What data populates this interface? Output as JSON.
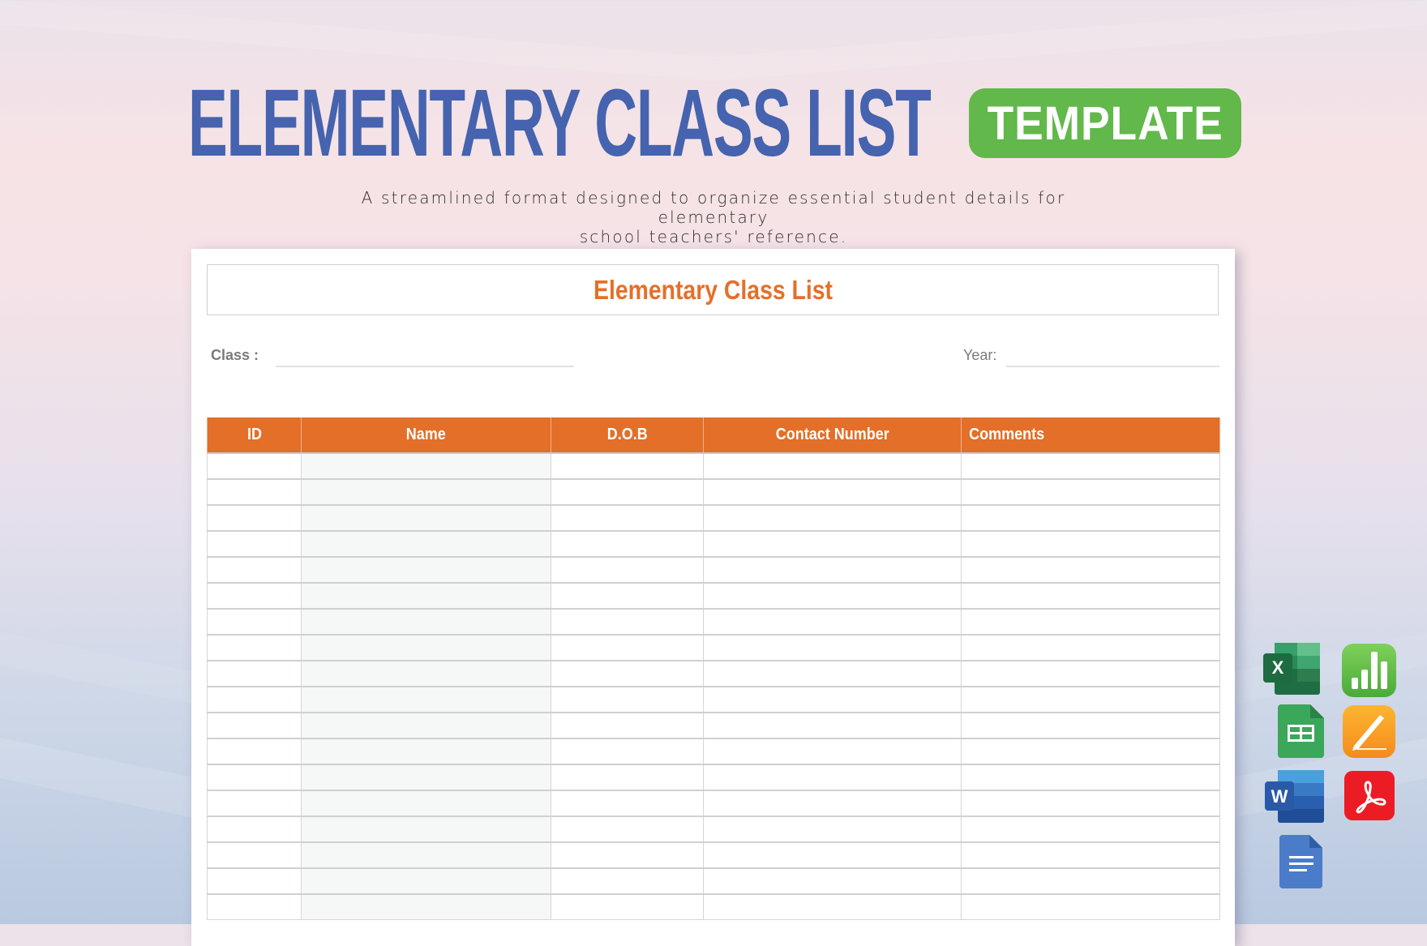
{
  "header": {
    "title": "ELEMENTARY CLASS LIST",
    "badge": "TEMPLATE",
    "subtitle_line1": "A streamlined format designed to organize essential student details for elementary",
    "subtitle_line2": "school teachers' reference."
  },
  "document": {
    "title": "Elementary Class List",
    "class_label": "Class :",
    "class_value": "",
    "year_label": "Year:",
    "year_value": "",
    "table": {
      "columns": [
        "ID",
        "Name",
        "D.O.B",
        "Contact Number",
        "Comments"
      ],
      "visible_empty_rows": 18,
      "rows": []
    }
  },
  "formats": [
    {
      "name": "Microsoft Excel",
      "icon": "excel-icon",
      "glyph": "X",
      "color": "#217346"
    },
    {
      "name": "Apple Numbers",
      "icon": "numbers-icon",
      "glyph": "",
      "color": "#5fbf3f"
    },
    {
      "name": "Google Sheets",
      "icon": "google-sheets-icon",
      "glyph": "",
      "color": "#33a853"
    },
    {
      "name": "Apple Pages",
      "icon": "pages-icon",
      "glyph": "",
      "color": "#f7931e"
    },
    {
      "name": "Microsoft Word",
      "icon": "word-icon",
      "glyph": "W",
      "color": "#2b5797"
    },
    {
      "name": "Adobe PDF",
      "icon": "pdf-icon",
      "glyph": "",
      "color": "#ec1c24"
    },
    {
      "name": "Google Docs",
      "icon": "google-docs-icon",
      "glyph": "",
      "color": "#4a7cc9"
    }
  ],
  "colors": {
    "title_blue": "#4563ae",
    "badge_green": "#62b84a",
    "accent_orange": "#e36f29"
  }
}
